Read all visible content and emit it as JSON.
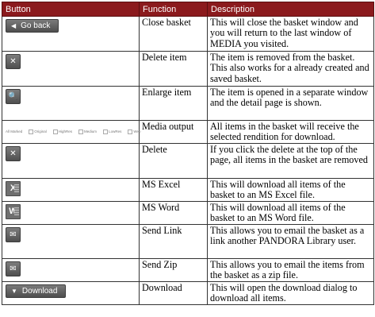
{
  "header": {
    "button": "Button",
    "function": "Function",
    "description": "Description"
  },
  "rows": [
    {
      "button_label": "Go back",
      "icon": "arrow-left-icon",
      "function": "Close basket",
      "description": "This will close the basket window and you will return to the last window of MEDIA you visited."
    },
    {
      "icon": "close-x-icon",
      "function": "Delete item",
      "description": "The item is removed from the basket. This also works for a already created and saved basket."
    },
    {
      "icon": "zoom-plus-icon",
      "function": "Enlarge item",
      "description": "The item is opened in a separate window and the detail page is shown."
    },
    {
      "icon": "media-output-bar",
      "function": "Media output",
      "description": "All items in the basket will receive the selected rendition for download."
    },
    {
      "icon": "close-x-icon",
      "function": "Delete",
      "description": "If you click the delete at the top of the page, all items in the basket are removed"
    },
    {
      "icon": "excel-icon",
      "function": "MS Excel",
      "description": "This will download all items of the basket to an MS Excel file."
    },
    {
      "icon": "word-icon",
      "function": "MS Word",
      "description": "This will download all items of the basket to an MS Word file."
    },
    {
      "icon": "envelope-icon",
      "function": "Send Link",
      "description": "This allows you to email the basket as a link another PANDORA Library user."
    },
    {
      "icon": "envelope-icon",
      "function": "Send Zip",
      "description": "This allows you to email the items from the basket as a zip file."
    },
    {
      "button_label": "Download",
      "icon": "arrow-down-icon",
      "function": "Download",
      "description": "This will open the download dialog to download all items."
    }
  ],
  "media_output_bar": {
    "all_marked": "All Marked",
    "options": [
      "Original",
      "HighRes",
      "Medium",
      "LowRes",
      "Web"
    ]
  }
}
